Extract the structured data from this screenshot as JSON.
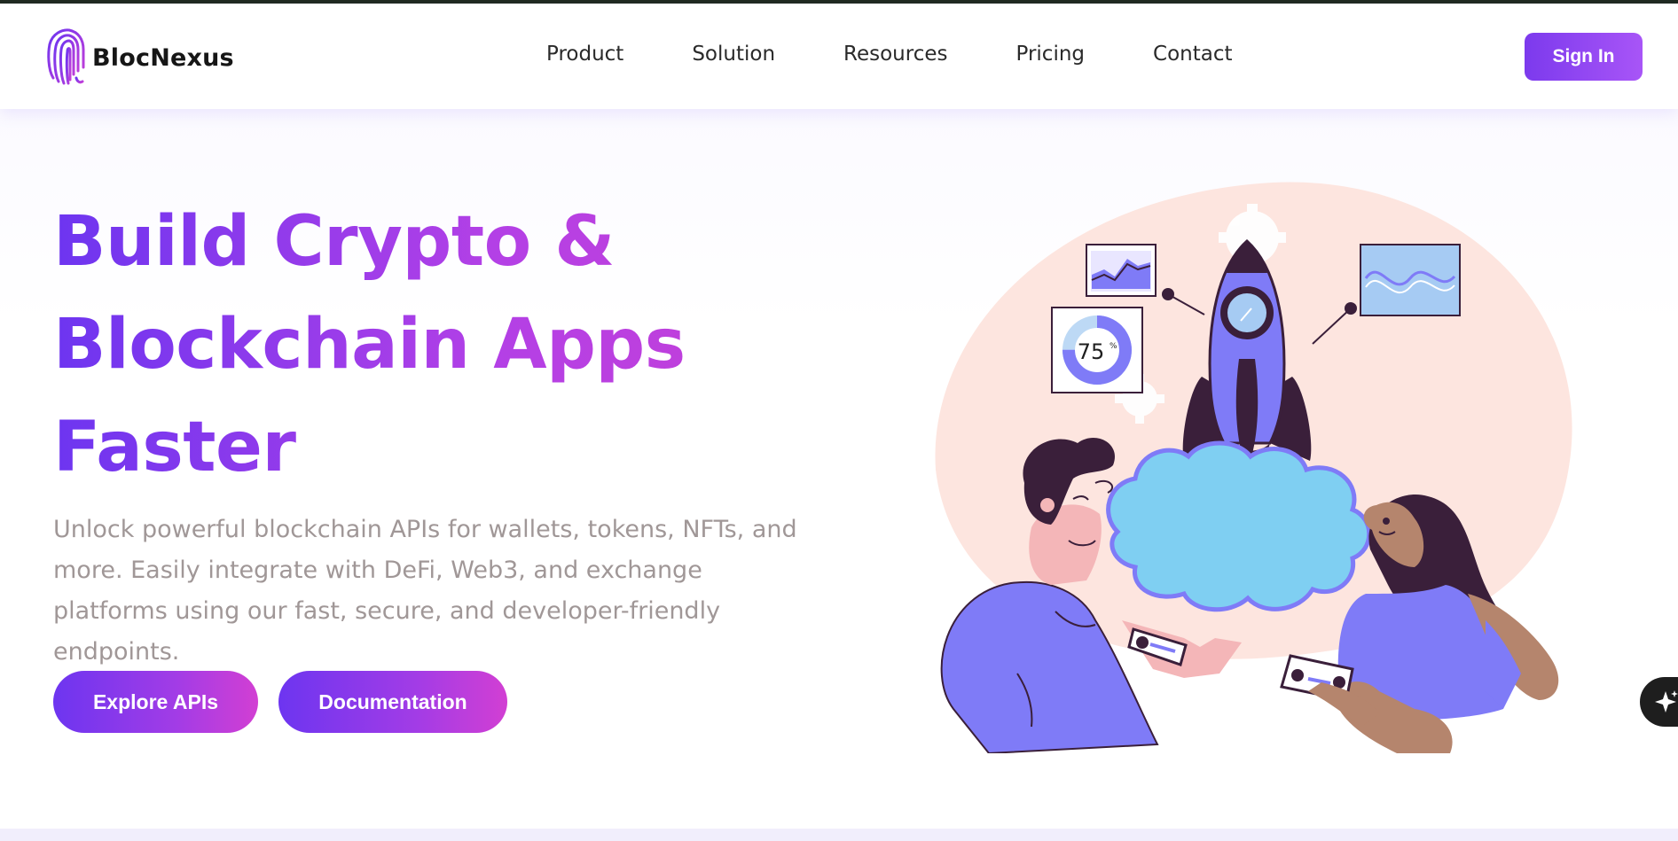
{
  "brand": {
    "name": "BlocNexus",
    "accent": "#7c3aed",
    "accent_end": "#c43fd8"
  },
  "nav": {
    "items": [
      {
        "label": "Product"
      },
      {
        "label": "Solution"
      },
      {
        "label": "Resources"
      },
      {
        "label": "Pricing"
      },
      {
        "label": "Contact"
      }
    ],
    "sign_in_label": "Sign In"
  },
  "hero": {
    "title_line_1": "Build Crypto &",
    "title_line_2": "Blockchain Apps",
    "title_line_3": "Faster",
    "description": "Unlock powerful blockchain APIs for wallets, tokens, NFTs, and more. Easily integrate with DeFi, Web3, and exchange platforms using our fast, secure, and developer-friendly endpoints.",
    "primary_button": "Explore APIs",
    "secondary_button": "Documentation"
  },
  "illustration": {
    "progress_label": "75",
    "progress_unit": "%",
    "progress_value": 0.75
  },
  "icons": {
    "logo": "fingerprint-icon",
    "fab": "sparkle-icon"
  }
}
